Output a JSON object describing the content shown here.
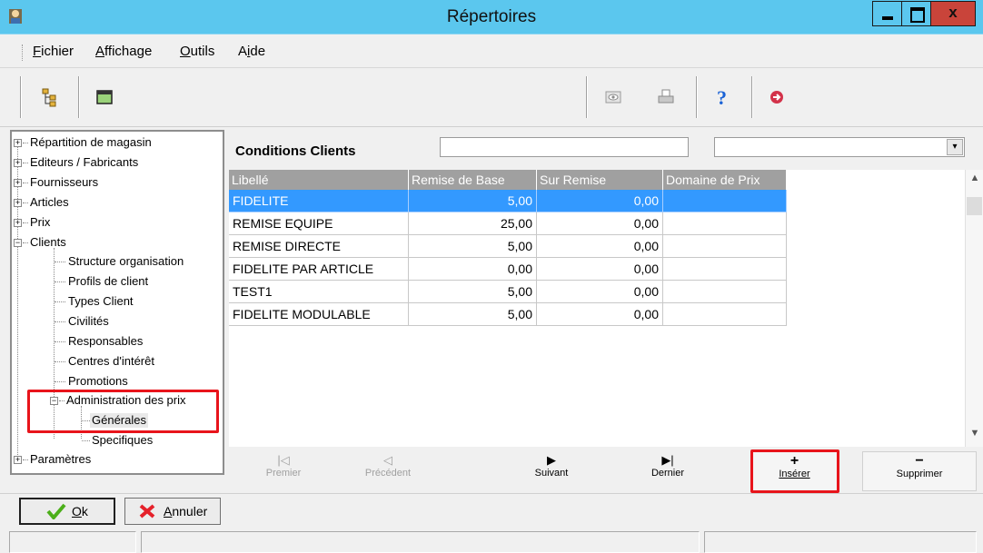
{
  "window": {
    "title": "Répertoires"
  },
  "menu": [
    {
      "pre": "",
      "u": "F",
      "post": "ichier"
    },
    {
      "pre": "",
      "u": "A",
      "post": "ffichage"
    },
    {
      "pre": "",
      "u": "O",
      "post": "utils"
    },
    {
      "pre": "A",
      "u": "i",
      "post": "de"
    }
  ],
  "toolbar": {
    "icons": [
      "tree-view-icon",
      "window-icon",
      "preview-icon",
      "print-icon",
      "help-icon",
      "exit-icon"
    ]
  },
  "tree": {
    "repartition": "Répartition de magasin",
    "editeurs": "Editeurs / Fabricants",
    "fournisseurs": "Fournisseurs",
    "articles": "Articles",
    "prix": "Prix",
    "clients": "Clients",
    "structure": "Structure organisation",
    "profils": "Profils de client",
    "types": "Types Client",
    "civilites": "Civilités",
    "responsables": "Responsables",
    "centres": "Centres d'intérêt",
    "promotions": "Promotions",
    "admin_prix": "Administration des prix",
    "generales": "Générales",
    "specifiques": "Specifiques",
    "parametres": "Paramètres",
    "expand_plus": "+",
    "expand_minus": "−"
  },
  "panel": {
    "title": "Conditions Clients",
    "search_value": "",
    "select_value": "",
    "select_arrow": "▾"
  },
  "grid": {
    "columns": [
      "Libellé",
      "Remise de Base",
      "Sur Remise",
      "Domaine de Prix"
    ],
    "rows": [
      [
        "FIDELITE",
        "5,00",
        "0,00",
        ""
      ],
      [
        "REMISE EQUIPE",
        "25,00",
        "0,00",
        ""
      ],
      [
        "REMISE DIRECTE",
        "5,00",
        "0,00",
        ""
      ],
      [
        "FIDELITE PAR ARTICLE",
        "0,00",
        "0,00",
        ""
      ],
      [
        "TEST1",
        "5,00",
        "0,00",
        ""
      ],
      [
        "FIDELITE MODULABLE",
        "5,00",
        "0,00",
        ""
      ]
    ],
    "selected_row": 0
  },
  "nav": {
    "first": "Premier",
    "previous": "Précédent",
    "next": "Suivant",
    "last": "Dernier",
    "insert": "Insérer",
    "delete": "Supprimer"
  },
  "buttons": {
    "ok_u": "O",
    "ok_rest": "k",
    "cancel_u": "A",
    "cancel_rest": "nnuler"
  },
  "colors": {
    "titlebar": "#5bc7ee",
    "selection": "#3399ff",
    "highlight": "#e8141b"
  }
}
